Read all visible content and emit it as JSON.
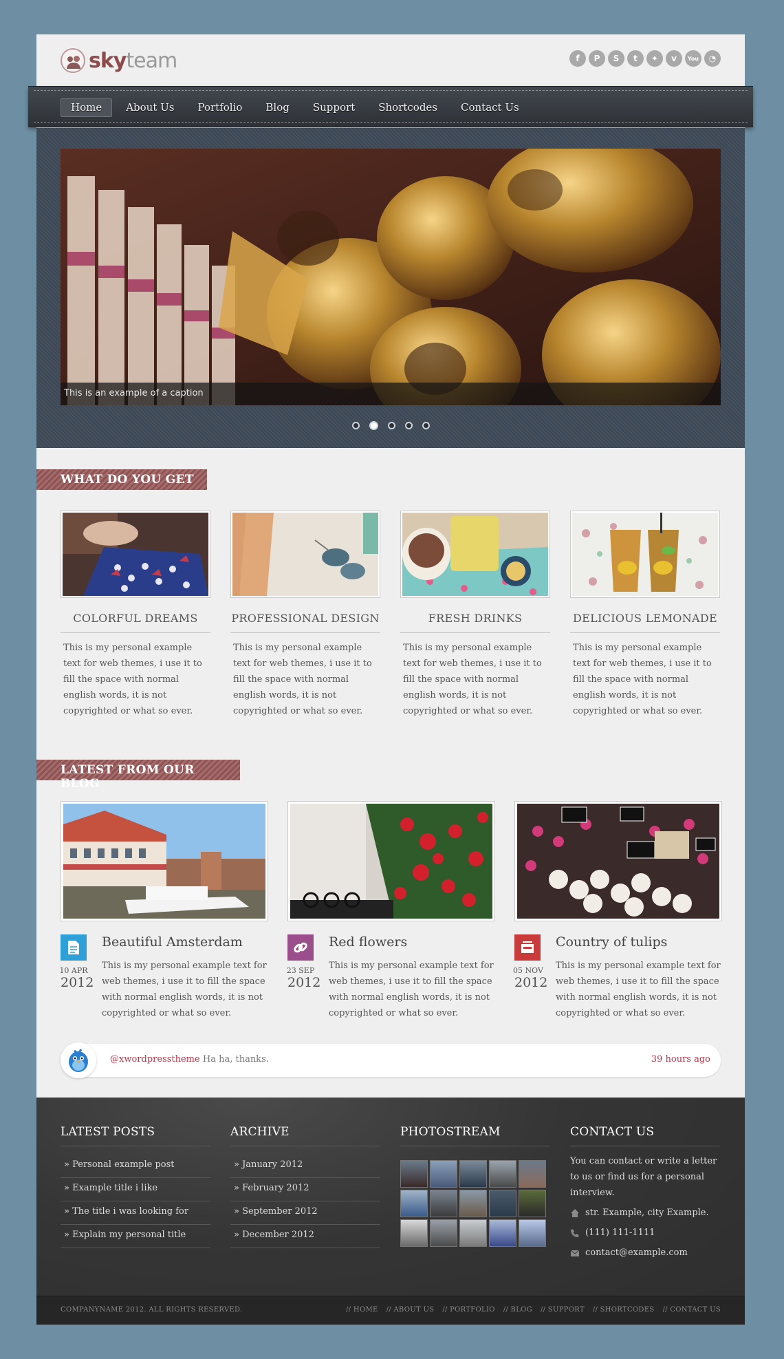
{
  "brand": {
    "name_part1": "sky",
    "name_part2": "team"
  },
  "social_icons": [
    "facebook-icon",
    "pinterest-icon",
    "skype-icon",
    "tumblr-icon",
    "twitter-icon",
    "vimeo-icon",
    "youtube-icon",
    "rss-icon"
  ],
  "nav": {
    "items": [
      "Home",
      "About Us",
      "Portfolio",
      "Blog",
      "Support",
      "Shortcodes",
      "Contact Us"
    ],
    "active": "Home"
  },
  "slider": {
    "caption": "This is an example of a caption",
    "slides": 5,
    "active_slide": 2
  },
  "features": {
    "title": "WHAT DO YOU GET",
    "items": [
      {
        "title": "COLORFUL DREAMS",
        "text": "This is my personal example text for web themes, i use it to fill the space with normal english words, it is not copyrighted or what so ever."
      },
      {
        "title": "PROFESSIONAL DESIGN",
        "text": "This is my personal example text for web themes, i use it to fill the space with normal english words, it is not copyrighted or what so ever."
      },
      {
        "title": "FRESH DRINKS",
        "text": "This is my personal example text for web themes, i use it to fill the space with normal english words, it is not copyrighted or what so ever."
      },
      {
        "title": "DELICIOUS LEMONADE",
        "text": "This is my personal example text for web themes, i use it to fill the space with normal english words, it is not copyrighted or what so ever."
      }
    ]
  },
  "blog": {
    "title": "LATEST FROM OUR BLOG",
    "posts": [
      {
        "title": "Beautiful Amsterdam",
        "day": "10 APR",
        "year": "2012",
        "icon": "document-icon",
        "color": "#2f9fd8",
        "text": "This is my personal example text for web themes, i use it to fill the space with normal english words, it is not copyrighted or what so ever."
      },
      {
        "title": "Red flowers",
        "day": "23 SEP",
        "year": "2012",
        "icon": "link-icon",
        "color": "#9b4e8c",
        "text": "This is my personal example text for web themes, i use it to fill the space with normal english words, it is not copyrighted or what so ever."
      },
      {
        "title": "Country of tulips",
        "day": "05 NOV",
        "year": "2012",
        "icon": "gallery-icon",
        "color": "#c93a3a",
        "text": "This is my personal example text for web themes, i use it to fill the space with normal english words, it is not copyrighted or what so ever."
      }
    ]
  },
  "tweet": {
    "user": "@xwordpresstheme",
    "text": "Ha ha, thanks.",
    "time": "39 hours ago"
  },
  "footer": {
    "latest_posts": {
      "title": "LATEST POSTS",
      "items": [
        "» Personal example post",
        "» Example title i like",
        "» The title i was looking for",
        "» Explain my personal title"
      ]
    },
    "archive": {
      "title": "ARCHIVE",
      "items": [
        "» January 2012",
        "» February 2012",
        "» September 2012",
        "» December 2012"
      ]
    },
    "photostream": {
      "title": "PHOTOSTREAM"
    },
    "contact": {
      "title": "CONTACT US",
      "text": "You can contact or write a letter to us or find us for a personal interview.",
      "address": "str. Example, city Example.",
      "phone": "(111) 111-1111",
      "email": "contact@example.com"
    },
    "copyright": "COMPANYNAME 2012. ALL RIGHTS RESERVED.",
    "nav": [
      "// HOME",
      "// ABOUT US",
      "// PORTFOLIO",
      "// BLOG",
      "// SUPPORT",
      "// SHORTCODES",
      "// CONTACT US"
    ]
  },
  "colors": {
    "background": "#6e8fa3",
    "accent": "#b8384a",
    "ribbon": "#9a5f5f",
    "footer": "#353535"
  }
}
